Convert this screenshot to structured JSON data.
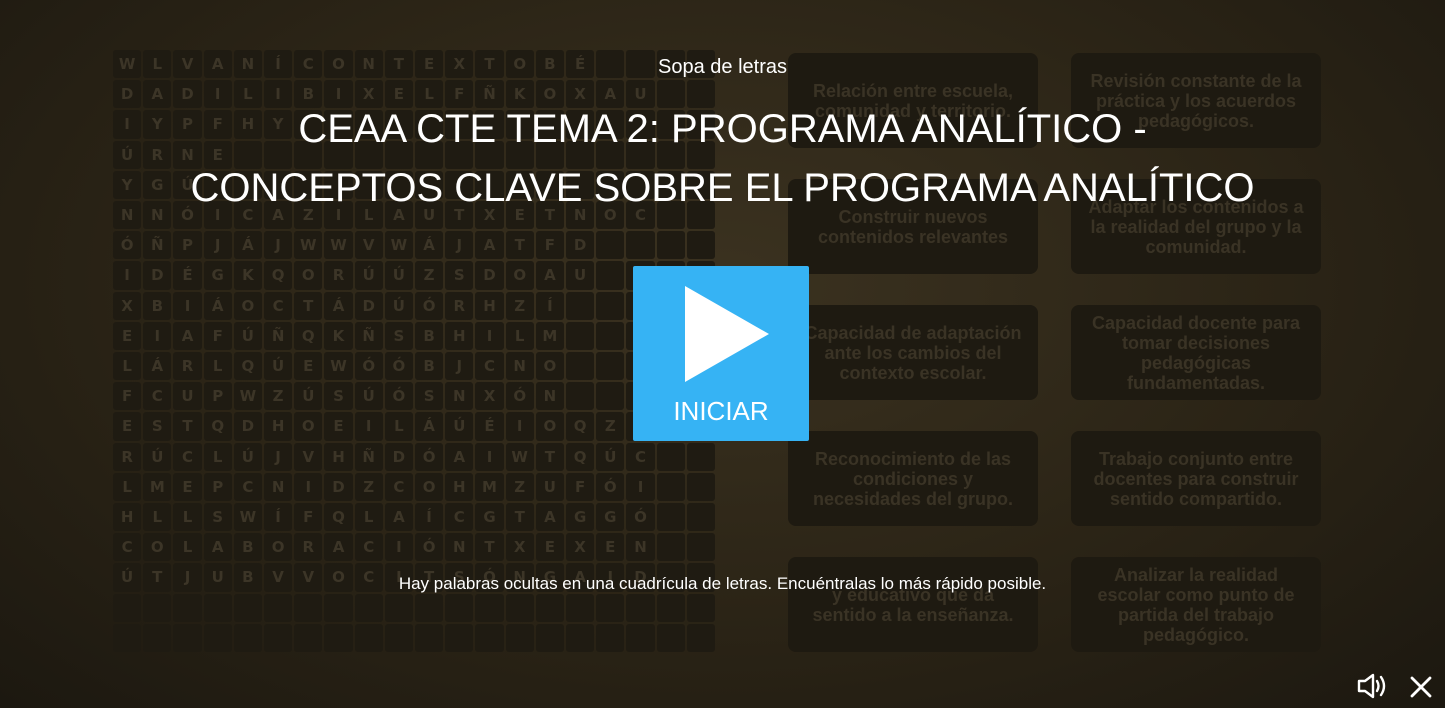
{
  "header": {
    "activity_type": "Sopa de letras",
    "title": "CEAA CTE TEMA 2: PROGRAMA ANALÍTICO - CONCEPTOS CLAVE SOBRE EL PROGRAMA ANALÍTICO"
  },
  "start_button": {
    "label": "INICIAR",
    "icon": "play-icon"
  },
  "instructions": "Hay palabras ocultas en una cuadrícula de letras. Encuéntralas lo más rápido posible.",
  "controls": {
    "sound_icon": "speaker-icon",
    "close_icon": "close-icon"
  },
  "grid_rows": [
    "WLVANÍCONTEXTOBÉ",
    "DADILIBIXELFÑKOXAU",
    "IYPFHY",
    "ÚRNE",
    "YGÚ",
    "NNÓICAZILAUTXETNOC",
    "ÓÑPJÁJWWVWÁJATFD",
    "IDÉGKQORÚÚZSDOAU",
    "XBIÁOCTÁDÚÓRHZÍ",
    "EIAFÚÑQKÑSBHILM",
    "LÁRLQÚEWÓÓBJCNO",
    "FCUPWZÚSÚÓSNXÓN",
    "ESTQDHOEILÁÚÉIOQZA",
    "RÚCLÚJVHÑDÓAIWTQÚC",
    "LMEPCNIDZCOHMZUFÓI",
    "HLLSWÍFQLAÍCGTAGGÓ",
    "COLABORACIÓNTXEXEN",
    "ÚTJUBVVOCITSÓNGAID"
  ],
  "cards": [
    "Relación entre escuela, comunidad y territorio.",
    "Revisión constante de la práctica y los acuerdos pedagógicos.",
    "Construir nuevos contenidos relevantes",
    "Adaptar los contenidos a la realidad del grupo y la comunidad.",
    "Capacidad de adaptación ante los cambios del contexto escolar.",
    "Capacidad docente para tomar decisiones pedagógicas fundamentadas.",
    "Reconocimiento de las condiciones y necesidades del grupo.",
    "Trabajo conjunto entre docentes para construir sentido compartido.",
    "y educativo que da sentido a la enseñanza.",
    "Analizar la realidad escolar como punto de partida del trabajo pedagógico."
  ]
}
